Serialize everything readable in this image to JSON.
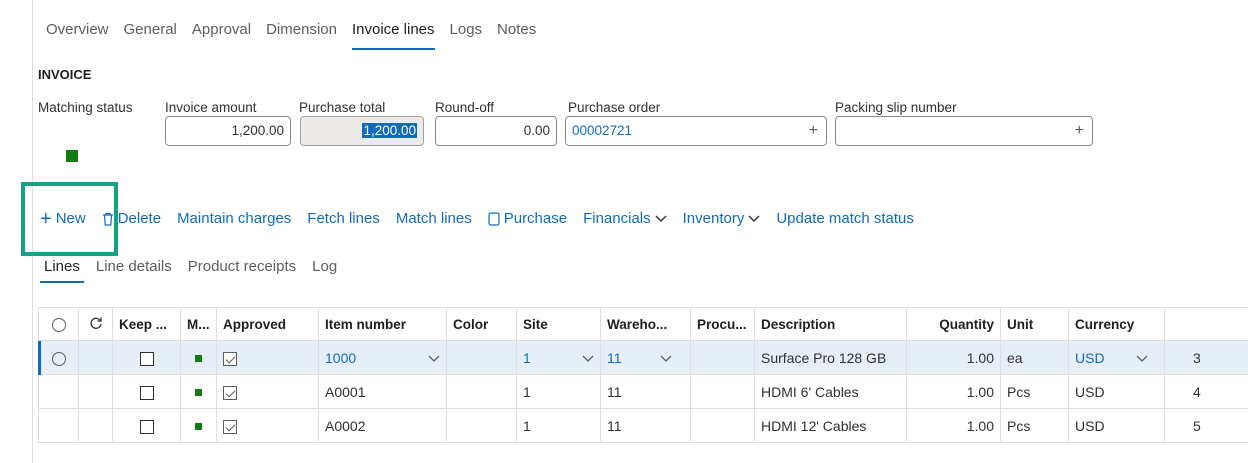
{
  "tabs": [
    "Overview",
    "General",
    "Approval",
    "Dimension",
    "Invoice lines",
    "Logs",
    "Notes"
  ],
  "active_tab": "Invoice lines",
  "section_title": "INVOICE",
  "fields": {
    "matching_status_label": "Matching status",
    "invoice_amount_label": "Invoice amount",
    "invoice_amount_value": "1,200.00",
    "purchase_total_label": "Purchase total",
    "purchase_total_value": "1,200.00",
    "round_off_label": "Round-off",
    "round_off_value": "0.00",
    "purchase_order_label": "Purchase order",
    "purchase_order_value": "00002721",
    "packing_slip_label": "Packing slip number",
    "packing_slip_value": ""
  },
  "toolbar": {
    "new": "New",
    "delete": "Delete",
    "maintain_charges": "Maintain charges",
    "fetch_lines": "Fetch lines",
    "match_lines": "Match lines",
    "purchase": "Purchase",
    "financials": "Financials",
    "inventory": "Inventory",
    "update_match_status": "Update match status"
  },
  "sub_tabs": [
    "Lines",
    "Line details",
    "Product receipts",
    "Log"
  ],
  "grid": {
    "headers": {
      "keep": "Keep ...",
      "m": "M...",
      "approved": "Approved",
      "item_number": "Item number",
      "color": "Color",
      "site": "Site",
      "warehouse": "Wareho...",
      "procurement": "Procu...",
      "description": "Description",
      "quantity": "Quantity",
      "unit": "Unit",
      "currency": "Currency",
      "extra": ""
    },
    "rows": [
      {
        "item": "1000",
        "site": "1",
        "warehouse": "11",
        "description": "Surface Pro 128 GB",
        "quantity": "1.00",
        "unit": "ea",
        "currency": "USD",
        "extra": "3"
      },
      {
        "item": "A0001",
        "site": "1",
        "warehouse": "11",
        "description": "HDMI 6' Cables",
        "quantity": "1.00",
        "unit": "Pcs",
        "currency": "USD",
        "extra": "4"
      },
      {
        "item": "A0002",
        "site": "1",
        "warehouse": "11",
        "description": "HDMI 12' Cables",
        "quantity": "1.00",
        "unit": "Pcs",
        "currency": "USD",
        "extra": "5"
      }
    ]
  },
  "colors": {
    "accent": "#0f6cbd",
    "status_green": "#107c10",
    "highlight": "#16a085"
  },
  "icons": {
    "new": "plus-icon",
    "delete": "trash-icon",
    "purchase": "document-icon",
    "refresh": "refresh-icon",
    "lookup": "add-lookup-icon",
    "dropdown": "chevron-down-icon"
  }
}
